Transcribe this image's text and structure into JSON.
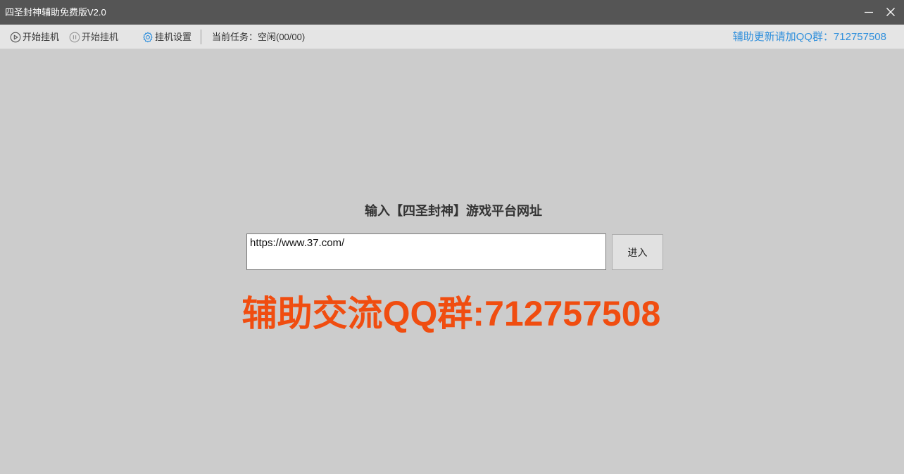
{
  "window": {
    "title": "四圣封神辅助免费版V2.0",
    "minimize_icon": "minimize-icon",
    "close_icon": "close-icon"
  },
  "toolbar": {
    "start_label": "开始挂机",
    "start_icon": "play-icon",
    "pause_label": "开始挂机",
    "pause_icon": "pause-icon",
    "settings_label": "挂机设置",
    "settings_icon": "gear-icon",
    "task_status": "当前任务：空闲(00/00)",
    "qq_link": "辅助更新请加QQ群：712757508"
  },
  "main": {
    "prompt": "输入【四圣封神】游戏平台网址",
    "url_value": "https://www.37.com/",
    "enter_button": "进入",
    "banner": "辅助交流QQ群:712757508"
  },
  "colors": {
    "titlebar": "#555555",
    "toolbar": "#e5e5e5",
    "background": "#cccccc",
    "qq_link": "#2f8fdc",
    "banner": "#f04d10",
    "settings_icon": "#2f8fdc"
  }
}
